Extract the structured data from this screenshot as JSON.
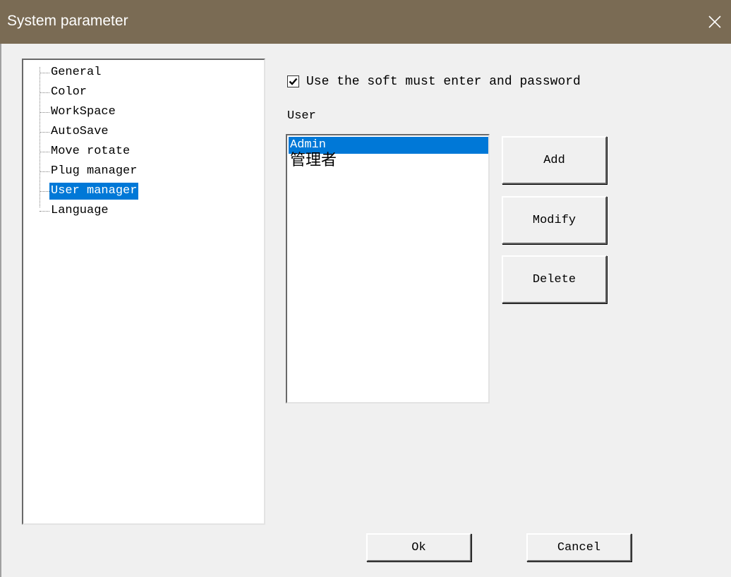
{
  "window": {
    "title": "System parameter",
    "close_icon": "close-icon"
  },
  "tree": {
    "items": [
      {
        "label": "General",
        "selected": false
      },
      {
        "label": "Color",
        "selected": false
      },
      {
        "label": "WorkSpace",
        "selected": false
      },
      {
        "label": "AutoSave",
        "selected": false
      },
      {
        "label": "Move rotate",
        "selected": false
      },
      {
        "label": "Plug manager",
        "selected": false
      },
      {
        "label": "User manager",
        "selected": true
      },
      {
        "label": "Language",
        "selected": false
      }
    ]
  },
  "options": {
    "require_password_label": "Use the soft must enter and password",
    "require_password_checked": true
  },
  "users": {
    "label": "User",
    "items": [
      {
        "name": "Admin",
        "selected": true
      },
      {
        "name": "管理者",
        "selected": false
      }
    ]
  },
  "buttons": {
    "add": "Add",
    "modify": "Modify",
    "delete": "Delete",
    "ok": "Ok",
    "cancel": "Cancel"
  },
  "colors": {
    "titlebar": "#7a6b54",
    "selection": "#0078d7",
    "background": "#f0f0f0"
  }
}
